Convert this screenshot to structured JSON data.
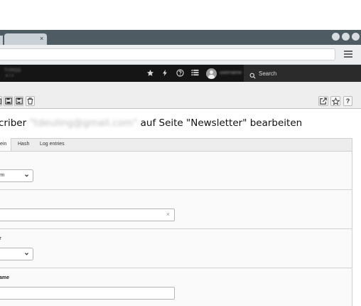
{
  "browser": {
    "tab_close": "×",
    "window_buttons": 3
  },
  "topbar": {
    "site_name": "TYPO3",
    "site_version": "8.7.0",
    "username": "username",
    "icons": [
      "star-icon",
      "flash-icon",
      "help-icon",
      "list-icon"
    ],
    "search_label": "Search"
  },
  "docheader": {
    "left_buttons": [
      "close-icon",
      "save-icon",
      "save-close-icon",
      "delete-icon"
    ],
    "right_buttons": [
      "open-new-window-icon",
      "bookmark-icon",
      "help-icon"
    ],
    "help_label": "?"
  },
  "page": {
    "heading_prefix": "criber",
    "heading_email": "\"tdeuling@gmail.com\"",
    "heading_suffix": " auf Seite \"Newsletter\" bearbeiten"
  },
  "tabs": [
    {
      "label": "ein"
    },
    {
      "label": "Hash"
    },
    {
      "label": "Log entries"
    }
  ],
  "form": {
    "field1_value": "ym",
    "field1_chevron": "⌄",
    "field2_clear": "×",
    "field3_label": "r",
    "field3_chevron": "⌄",
    "field4_label": "ame"
  }
}
